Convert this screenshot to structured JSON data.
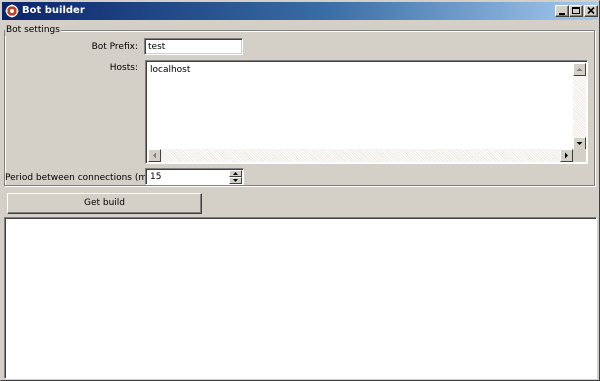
{
  "window": {
    "title": "Bot builder",
    "icon": "app-gear-icon",
    "controls": [
      "minimize-icon",
      "maximize-icon",
      "close-icon"
    ]
  },
  "settings": {
    "group_title": "Bot settings",
    "bot_prefix_label": "Bot Prefix:",
    "bot_prefix_value": "test",
    "hosts_label": "Hosts:",
    "hosts_value": "localhost",
    "period_label": "Period between connections (min):",
    "period_value": "15"
  },
  "actions": {
    "get_build_label": "Get build"
  },
  "output": {
    "text": ""
  },
  "colors": {
    "titlebar_start": "#0a246a",
    "titlebar_end": "#a6caf0",
    "face": "#d4d0c8"
  }
}
